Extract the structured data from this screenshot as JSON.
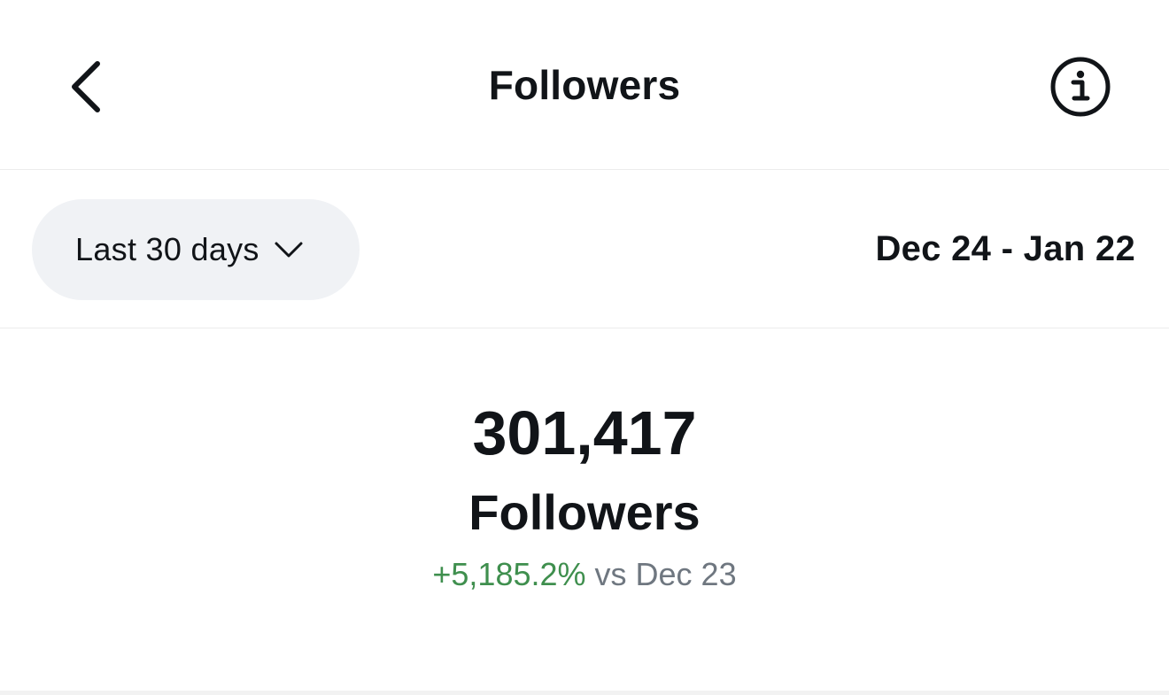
{
  "header": {
    "title": "Followers",
    "back_icon": "chevron-left-icon",
    "info_icon": "info-icon"
  },
  "filters": {
    "range_label": "Last 30 days",
    "range_icon": "chevron-down-icon",
    "date_range": "Dec 24 - Jan 22"
  },
  "stats": {
    "value": "301,417",
    "label": "Followers",
    "change": "+5,185.2%",
    "comparison": "vs Dec 23"
  },
  "colors": {
    "text": "#111418",
    "positive": "#3f8f4e",
    "muted": "#6f7780",
    "pill_bg": "#f0f2f5"
  }
}
